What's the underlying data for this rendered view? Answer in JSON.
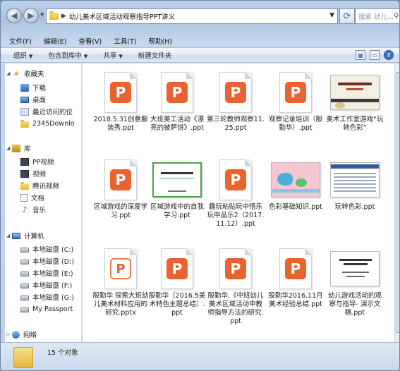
{
  "address": {
    "path": "幼儿美术区域活动观察指导PPT讲义",
    "search_placeholder": "搜索 幼儿..."
  },
  "menu": [
    "文件(F)",
    "编辑(E)",
    "查看(V)",
    "工具(T)",
    "帮助(H)"
  ],
  "toolbar": {
    "organize": "组织",
    "include_library": "包含到库中",
    "share": "共享",
    "new_folder": "新建文件夹"
  },
  "sidebar": {
    "favorites": {
      "title": "收藏夹",
      "items": [
        "下载",
        "桌面",
        "最近访问的位",
        "2345Downlo"
      ]
    },
    "libraries": {
      "title": "库",
      "items": [
        "PP视频",
        "视频",
        "腾讯视频",
        "文档",
        "音乐"
      ]
    },
    "computer": {
      "title": "计算机",
      "items": [
        "本地磁盘 (C:)",
        "本地磁盘 (D:)",
        "本地磁盘 (E:)",
        "本地磁盘 (F:)",
        "本地磁盘 (G:)",
        "My Passport"
      ]
    },
    "network": {
      "title": "网络"
    }
  },
  "files": [
    {
      "name": "2018.5.31创意服装秀.ppt",
      "thumb": "ppt"
    },
    {
      "name": "大班美工活动《漂亮的披萨饼》.ppt",
      "thumb": "ppt"
    },
    {
      "name": "第三轮教师观察11.25.ppt",
      "thumb": "ppt"
    },
    {
      "name": "观察记录培训（殷勤华）.ppt",
      "thumb": "ppt"
    },
    {
      "name": "美术工作室游戏“玩转色彩”",
      "thumb": "slide-cream"
    },
    {
      "name": "区域游戏的深度学习.ppt",
      "thumb": "ppt"
    },
    {
      "name": "区域游戏中的自我学习.ppt",
      "thumb": "slide-green"
    },
    {
      "name": "趣玩粘贴玩中悟乐玩中品乐2（2017.11.12）.ppt",
      "thumb": "ppt"
    },
    {
      "name": "色彩基础知识.ppt",
      "thumb": "slide-pink"
    },
    {
      "name": "玩转色彩.ppt",
      "thumb": "slide-blue"
    },
    {
      "name": "殷勤华 探索大班幼儿美术材料应用的研究.pptx",
      "thumb": "pptx"
    },
    {
      "name": "殷勤华（2016.5美术特色主题总结）.ppt",
      "thumb": "ppt"
    },
    {
      "name": "殷勤华.《中班幼儿美术区域活动中教师指导方法的研究.ppt",
      "thumb": "ppt"
    },
    {
      "name": "殷勤华2016.11月美术经验总结.ppt",
      "thumb": "ppt"
    },
    {
      "name": "幼儿游戏活动的观察与指导- 演示文稿.ppt",
      "thumb": "slide-white"
    }
  ],
  "status": {
    "count_text": "15 个对象"
  }
}
